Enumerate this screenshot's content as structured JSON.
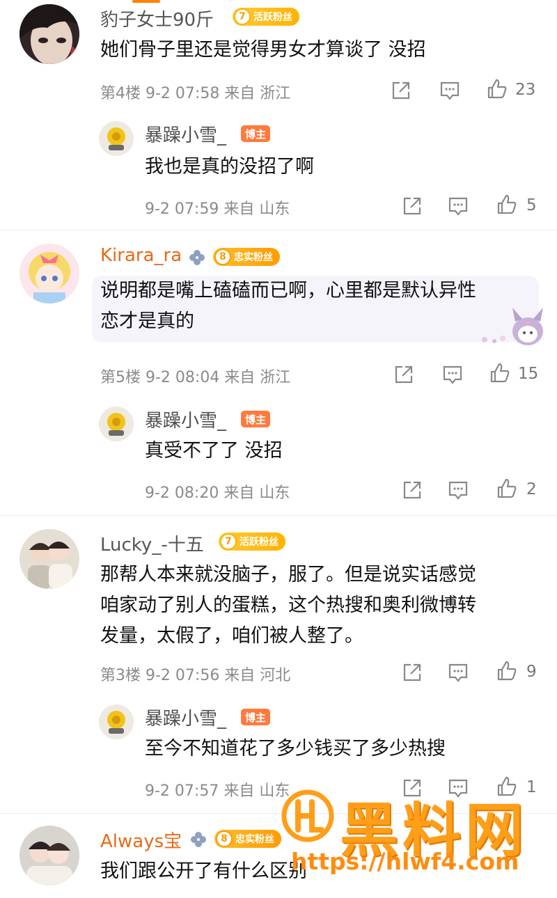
{
  "comments": [
    {
      "name": "豹子女士90斤",
      "badge_level": "7",
      "badge_label": "活跃粉丝",
      "text": "她们骨子里还是觉得男女才算谈了 没招",
      "meta": "第4楼 9-2 07:58 来自 浙江",
      "likes": "23",
      "reply": {
        "name": "暴躁小雪_",
        "tag": "博主",
        "text": "我也是真的没招了啊",
        "meta": "9-2 07:59 来自 山东",
        "likes": "5"
      }
    },
    {
      "name": "Kirara_ra",
      "badge_level": "8",
      "badge_label": "忠实粉丝",
      "text_line1": "说明都是嘴上磕磕而已啊，心里都是默认异性",
      "text_line2": "恋才是真的",
      "meta": "第5楼 9-2 08:04 来自 浙江",
      "likes": "15",
      "reply": {
        "name": "暴躁小雪_",
        "tag": "博主",
        "text": "真受不了了 没招",
        "meta": "9-2 08:20 来自 山东",
        "likes": "2"
      }
    },
    {
      "name": "Lucky_-十五",
      "badge_level": "7",
      "badge_label": "活跃粉丝",
      "text_line1": "那帮人本来就没脑子，服了。但是说实话感觉",
      "text_line2": "咱家动了别人的蛋糕，这个热搜和奥利微博转",
      "text_line3": "发量，太假了，咱们被人整了。",
      "meta": "第3楼 9-2 07:56 来自 河北",
      "likes": "9",
      "reply": {
        "name": "暴躁小雪_",
        "tag": "博主",
        "text": "至今不知道花了多少钱买了多少热搜",
        "meta": "9-2 07:57 来自 山东",
        "likes": "1"
      }
    },
    {
      "name": "Always宝",
      "badge_level": "8",
      "badge_label": "忠实粉丝",
      "text": "我们跟公开了有什么区别"
    }
  ],
  "watermark": {
    "title": "黑料网",
    "url": "https://hlwf4.com"
  },
  "colors": {
    "accent_orange": "#ff8200",
    "username_orange": "#e86a17",
    "meta_grey": "#8a8a8a"
  }
}
